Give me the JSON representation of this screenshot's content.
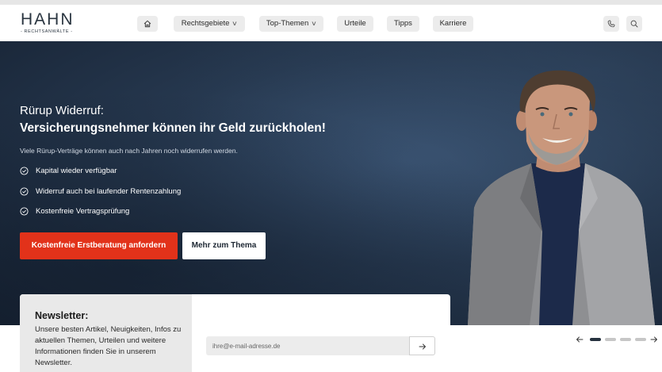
{
  "logo": {
    "word": "HAHN",
    "sub": "- RECHTSANWÄLTE -"
  },
  "nav": {
    "items": [
      {
        "label": "Rechtsgebiete",
        "has_dropdown": true
      },
      {
        "label": "Top-Themen",
        "has_dropdown": true
      },
      {
        "label": "Urteile",
        "has_dropdown": false
      },
      {
        "label": "Tipps",
        "has_dropdown": false
      },
      {
        "label": "Karriere",
        "has_dropdown": false
      }
    ],
    "dropdown_glyph": "∨",
    "icons": [
      "home-icon",
      "phone-icon",
      "search-icon"
    ]
  },
  "hero": {
    "eyebrow": "Rürup Widerruf:",
    "headline": "Versicherungsnehmer können ihr Geld zurückholen!",
    "lead": "Viele Rürup-Verträge können auch nach Jahren noch widerrufen werden.",
    "checks": [
      "Kapital wieder verfügbar",
      "Widerruf auch bei laufender Rentenzahlung",
      "Kostenfreie Vertragsprüfung"
    ],
    "primary_cta": "Kostenfreie Erstberatung anfordern",
    "secondary_cta": "Mehr zum Thema"
  },
  "newsletter": {
    "title": "Newsletter:",
    "text": "Unsere besten Artikel, Neuigkeiten, Infos zu aktuellen Themen, Urteilen und weitere Informationen finden Sie in unserem Newsletter.",
    "email_placeholder": "ihre@e-mail-adresse.de",
    "submit_icon": "arrow-right-icon"
  },
  "slider": {
    "slide_count": 4,
    "active_index": 0
  },
  "colors": {
    "accent": "#e2321a",
    "hero_bg": "#26384f",
    "nav_pill": "#ececec",
    "logo": "#2a3540",
    "dot_active": "#26323f",
    "dot_inactive": "#c7c7c7"
  }
}
